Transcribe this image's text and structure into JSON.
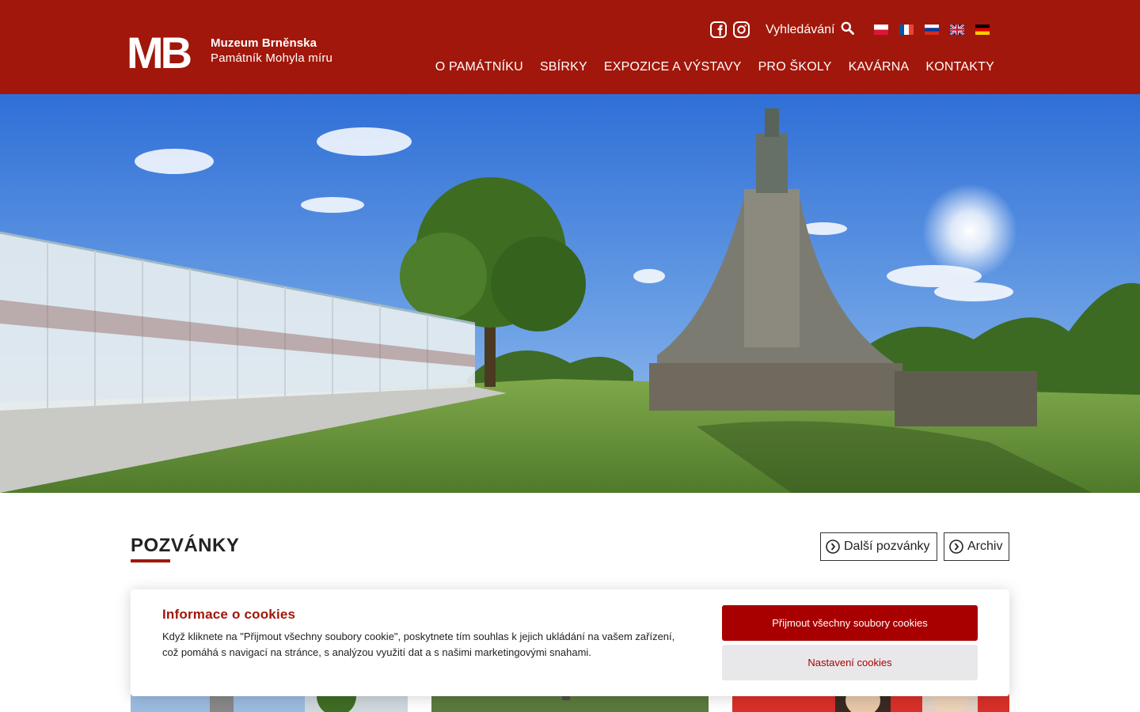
{
  "colors": {
    "brand_red": "#a1170b",
    "button_red": "#a80000",
    "settings_bg": "#e8e8ea"
  },
  "header": {
    "logo_letters": "MB",
    "logo_line1": "Muzeum Brněnska",
    "logo_line2": "Památník Mohyla míru",
    "social": [
      "facebook-icon",
      "instagram-icon"
    ],
    "search_label": "Vyhledávání",
    "languages": [
      "pl",
      "fr",
      "ru",
      "en",
      "de"
    ]
  },
  "nav": {
    "items": [
      "O PAMÁTNÍKU",
      "SBÍRKY",
      "EXPOZICE A VÝSTAVY",
      "PRO ŠKOLY",
      "KAVÁRNA",
      "KONTAKTY"
    ]
  },
  "section": {
    "title": "POZVÁNKY",
    "more_button": "Další pozvánky",
    "archive_button": "Archiv"
  },
  "cookie": {
    "title": "Informace o cookies",
    "text": "Když kliknete na \"Přijmout všechny soubory cookie\", poskytnete tím souhlas k jejich ukládání na vašem zařízení, což pomáhá s navigací na stránce, s analýzou využití dat a s našimi marketingovými snahami.",
    "accept": "Přijmout všechny soubory cookies",
    "settings": "Nastavení cookies"
  }
}
